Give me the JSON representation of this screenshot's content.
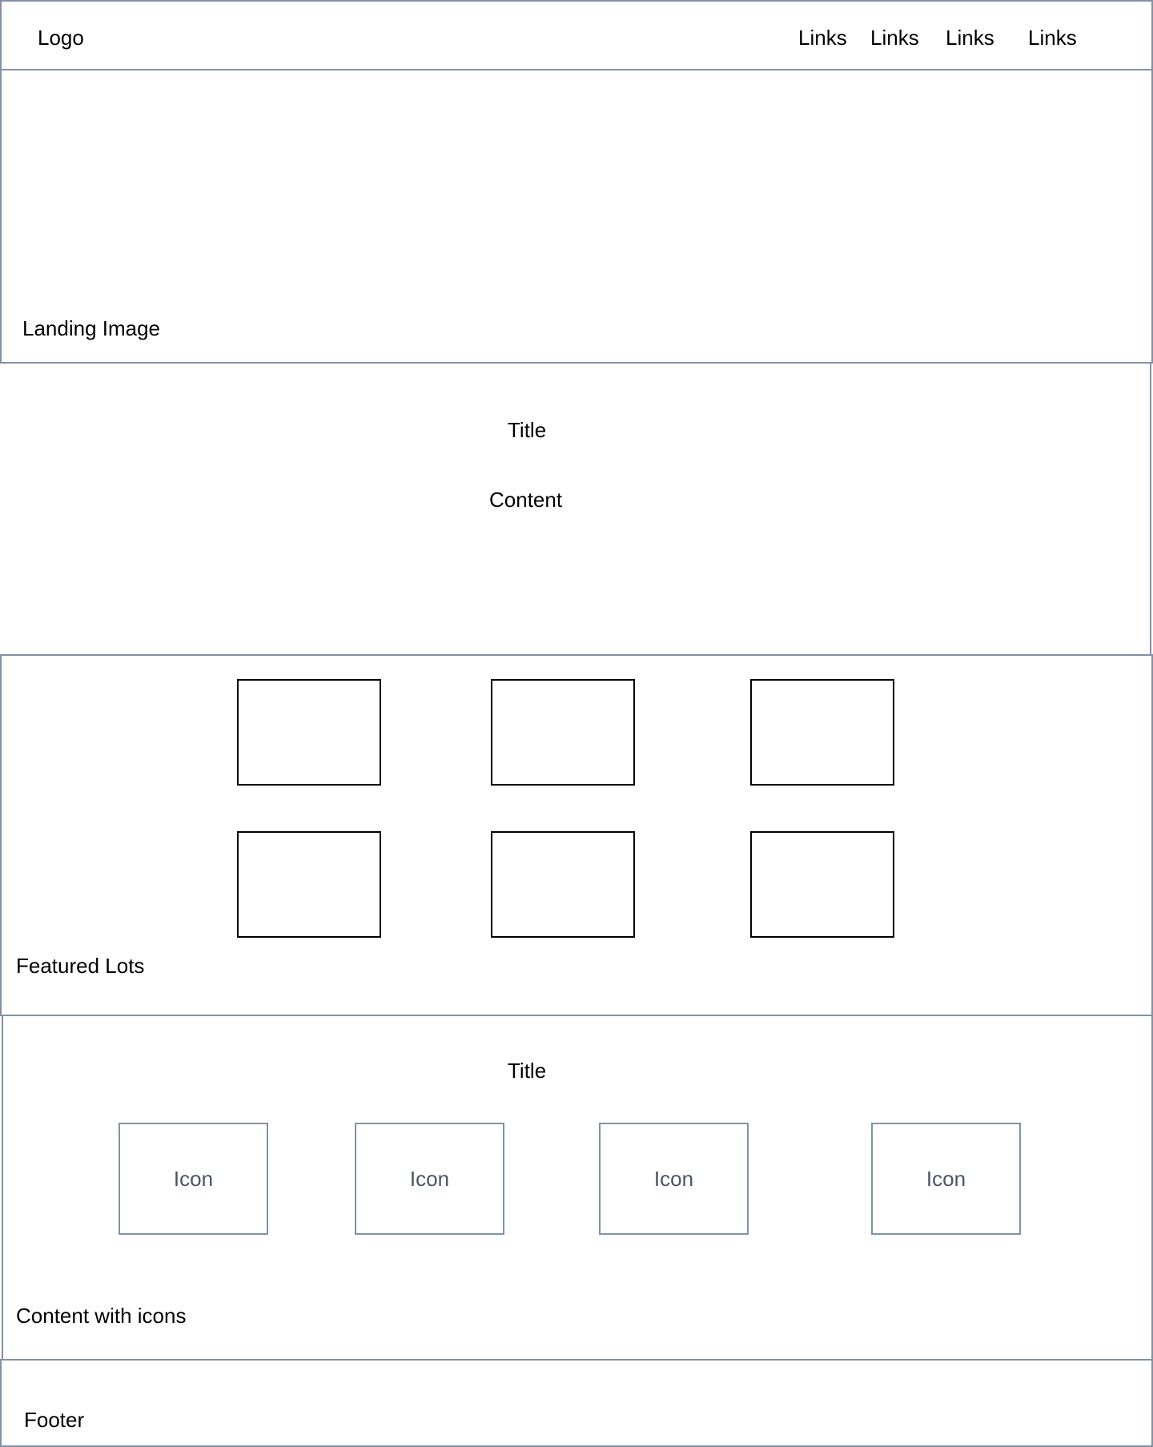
{
  "header": {
    "logo": "Logo",
    "links": [
      "Links",
      "Links",
      "Links",
      "Links"
    ]
  },
  "landing": {
    "label": "Landing Image"
  },
  "intro": {
    "title": "Title",
    "content": "Content"
  },
  "featured": {
    "label": "Featured Lots"
  },
  "icons_section": {
    "title": "Title",
    "icons": [
      "Icon",
      "Icon",
      "Icon",
      "Icon"
    ],
    "label": "Content with icons"
  },
  "footer": {
    "label": "Footer"
  },
  "colors": {
    "border": "#8391a5",
    "box_border": "#000000",
    "icon_text": "#4a5566"
  }
}
